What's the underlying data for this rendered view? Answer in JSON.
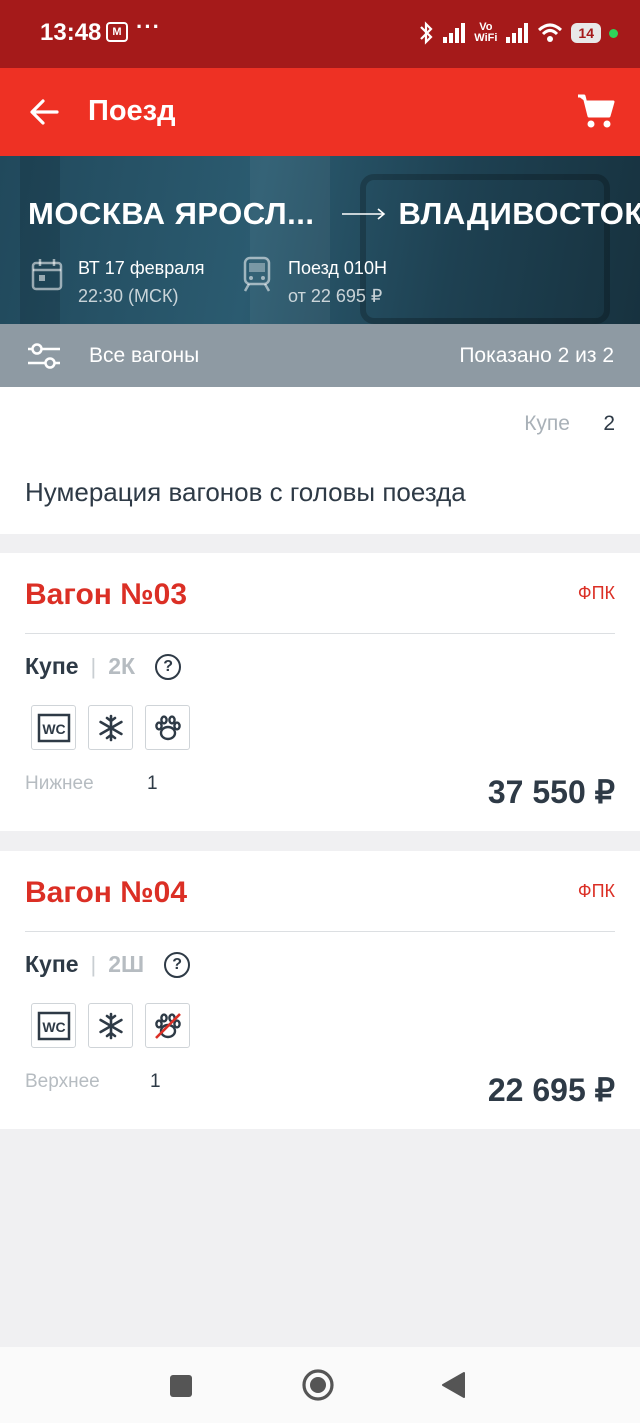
{
  "status_bar": {
    "time": "13:48",
    "carrier_icon": "M",
    "dots": "···",
    "vowifi_top": "Vo",
    "vowifi_bottom": "WiFi",
    "battery": "14"
  },
  "app_bar": {
    "title": "Поезд",
    "back_icon": "arrow-left-icon",
    "cart_icon": "cart-icon",
    "color": "#ee3124"
  },
  "route": {
    "from": "МОСКВА ЯРОСЛ...",
    "to": "ВЛАДИВОСТОК",
    "date_line1": "ВТ 17 февраля",
    "date_line2": "22:30 (МСК)",
    "train_line1": "Поезд 010Н",
    "train_line2": "от 22 695 ₽"
  },
  "filter": {
    "label": "Все вагоны",
    "count": "Показано 2 из 2"
  },
  "summary": {
    "type": "Купе",
    "count": "2",
    "note": "Нумерация вагонов с головы поезда"
  },
  "cars": [
    {
      "title": "Вагон №03",
      "carrier": "ФПК",
      "type": "Купе",
      "sep": "|",
      "class": "2К",
      "help": "?",
      "amenities": [
        "wc-icon",
        "snowflake-icon",
        "pets-allowed-icon"
      ],
      "amenity_wc_text": "WC",
      "seat_label": "Нижнее",
      "seat_count": "1",
      "price": "37 550 ₽"
    },
    {
      "title": "Вагон №04",
      "carrier": "ФПК",
      "type": "Купе",
      "sep": "|",
      "class": "2Ш",
      "help": "?",
      "amenities": [
        "wc-icon",
        "snowflake-icon",
        "pets-not-allowed-icon"
      ],
      "amenity_wc_text": "WC",
      "seat_label": "Верхнее",
      "seat_count": "1",
      "price": "22 695 ₽"
    }
  ],
  "colors": {
    "status_bar": "#a51a1a",
    "accent_red": "#db2f25",
    "text_dark": "#2e3a46",
    "filter_bar": "#8e9aa3"
  }
}
